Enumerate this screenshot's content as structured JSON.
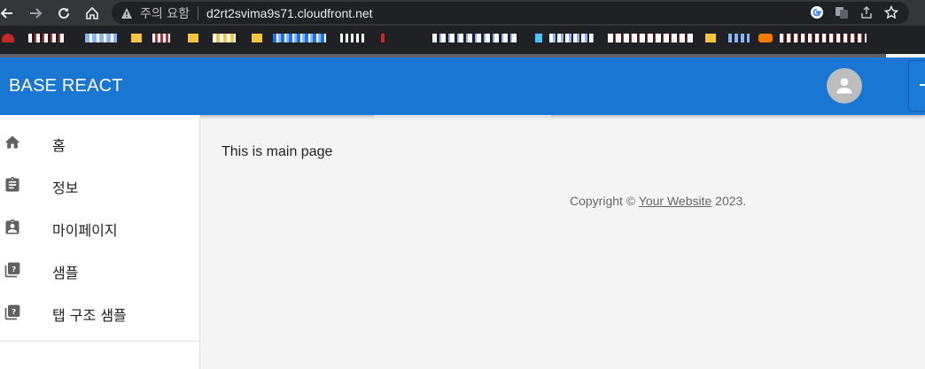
{
  "browser": {
    "warning_text": "주의 요함",
    "url": "d2rt2svima9s71.cloudfront.net",
    "icons": [
      "back-icon",
      "forward-icon",
      "reload-icon",
      "home-icon",
      "warning-icon",
      "google-icon",
      "translate-icon",
      "share-icon",
      "star-icon"
    ]
  },
  "header": {
    "title": "BASE REACT",
    "colors": {
      "appbar": "#1976d2",
      "avatar": "#bdbdbd"
    }
  },
  "sidebar": {
    "items": [
      {
        "label": "홈",
        "icon": "home-icon"
      },
      {
        "label": "정보",
        "icon": "clipboard-icon"
      },
      {
        "label": "마이페이지",
        "icon": "assignment-ind-icon"
      },
      {
        "label": "샘플",
        "icon": "library-question-icon"
      },
      {
        "label": "탭 구조 샘플",
        "icon": "library-question-icon"
      }
    ]
  },
  "main": {
    "text": "This is main page",
    "copyright_prefix": "Copyright © ",
    "copyright_link": "Your Website",
    "copyright_suffix": " 2023."
  }
}
